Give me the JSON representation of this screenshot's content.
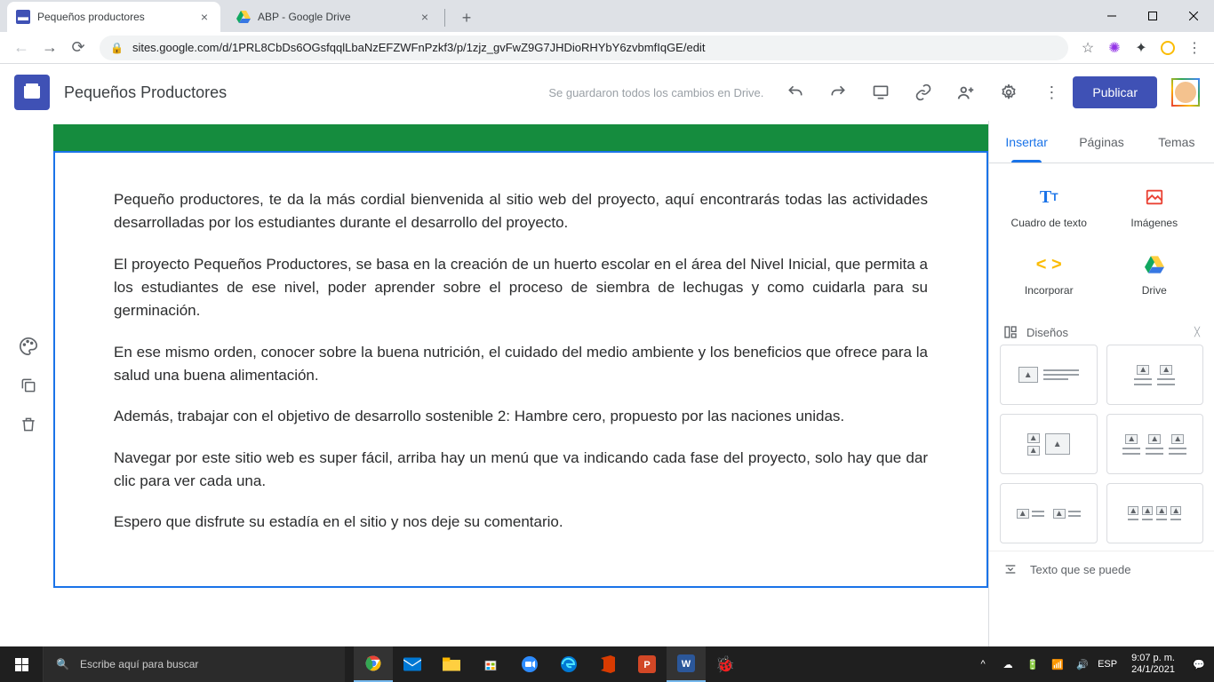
{
  "browser": {
    "tabs": [
      {
        "title": "Pequeños productores",
        "favicon_color": "#3f51b5"
      },
      {
        "title": "ABP - Google Drive",
        "favicon_color": "#0f9d58"
      }
    ],
    "url": "sites.google.com/d/1PRL8CbDs6OGsfqqlLbaNzEFZWFnPzkf3/p/1zjz_gvFwZ9G7JHDioRHYbY6zvbmfIqGE/edit"
  },
  "app": {
    "site_title": "Pequeños Productores",
    "save_status": "Se guardaron todos los cambios en Drive.",
    "publish_label": "Publicar"
  },
  "content": {
    "paragraphs": [
      "Pequeño productores, te da la más cordial bienvenida al sitio web del proyecto, aquí encontrarás todas las actividades desarrolladas por los estudiantes durante el desarrollo del proyecto.",
      "El proyecto Pequeños Productores, se basa en la creación de un huerto escolar en el área del Nivel Inicial, que permita a los estudiantes de ese nivel, poder aprender sobre el proceso de siembra de lechugas y como cuidarla para su germinación.",
      "En ese mismo orden, conocer sobre la buena nutrición, el cuidado del medio ambiente y los beneficios que ofrece para la salud una buena alimentación.",
      "Además, trabajar con el objetivo de desarrollo sostenible 2: Hambre cero, propuesto por las naciones unidas.",
      "Navegar por este sitio web es super fácil, arriba hay un menú que va indicando cada fase del proyecto, solo hay que dar clic para ver cada una.",
      "Espero que disfrute su estadía en el sitio y nos deje su comentario."
    ]
  },
  "panel": {
    "tabs": {
      "insert": "Insertar",
      "pages": "Páginas",
      "themes": "Temas"
    },
    "insert_items": {
      "textbox": "Cuadro de texto",
      "images": "Imágenes",
      "embed": "Incorporar",
      "drive": "Drive"
    },
    "layouts_label": "Diseños",
    "collapsible_label": "Texto que se puede"
  },
  "taskbar": {
    "search_placeholder": "Escribe aquí para buscar",
    "lang": "ESP",
    "time": "9:07 p. m.",
    "date": "24/1/2021"
  }
}
